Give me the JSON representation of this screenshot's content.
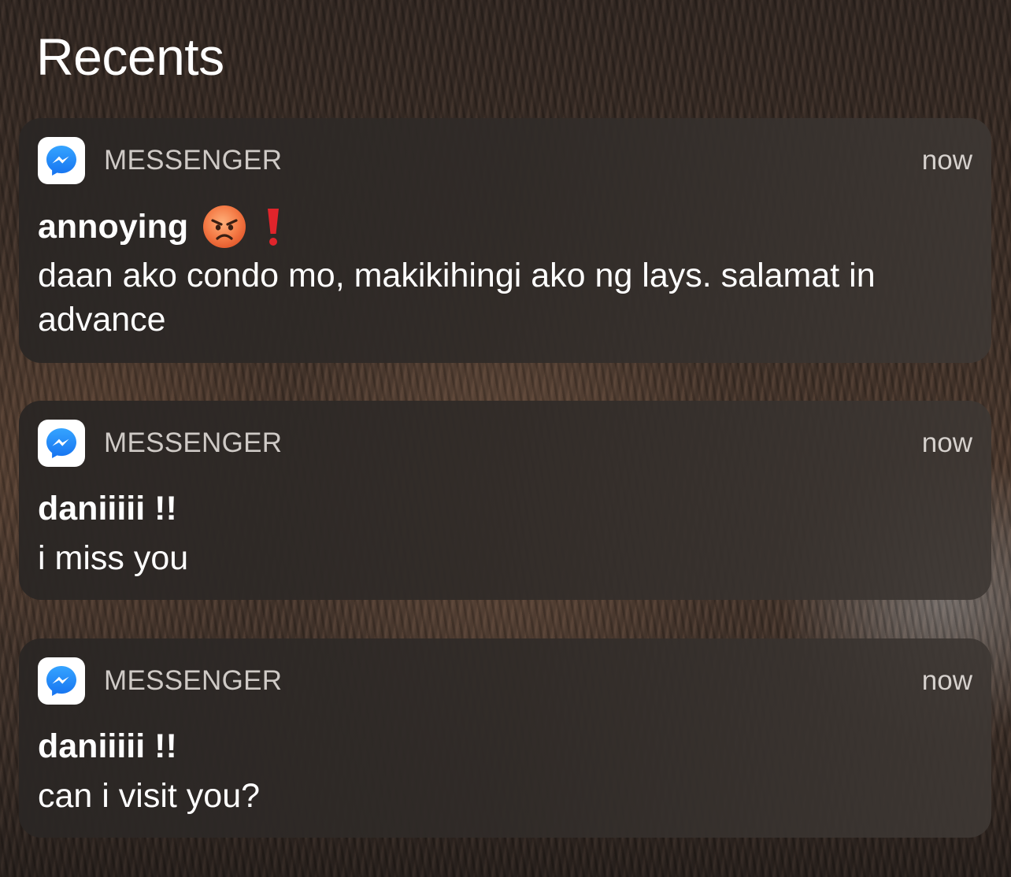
{
  "header": {
    "title": "Recents"
  },
  "notifications": [
    {
      "app_name": "MESSENGER",
      "time": "now",
      "sender": "annoying",
      "sender_emojis": [
        "angry-face-emoji",
        "red-exclamation-emoji"
      ],
      "message": "daan ako condo mo, makikihingi ako ng lays. salamat in advance"
    },
    {
      "app_name": "MESSENGER",
      "time": "now",
      "sender": "daniiiii !!",
      "message": "i miss you"
    },
    {
      "app_name": "MESSENGER",
      "time": "now",
      "sender": "daniiiii !!",
      "message": "can i visit you?"
    }
  ],
  "colors": {
    "messenger_blue": "#1f8cff",
    "card_background": "#2e2a28",
    "angry_face": "#f26a3d",
    "exclamation_red": "#e0242b"
  }
}
